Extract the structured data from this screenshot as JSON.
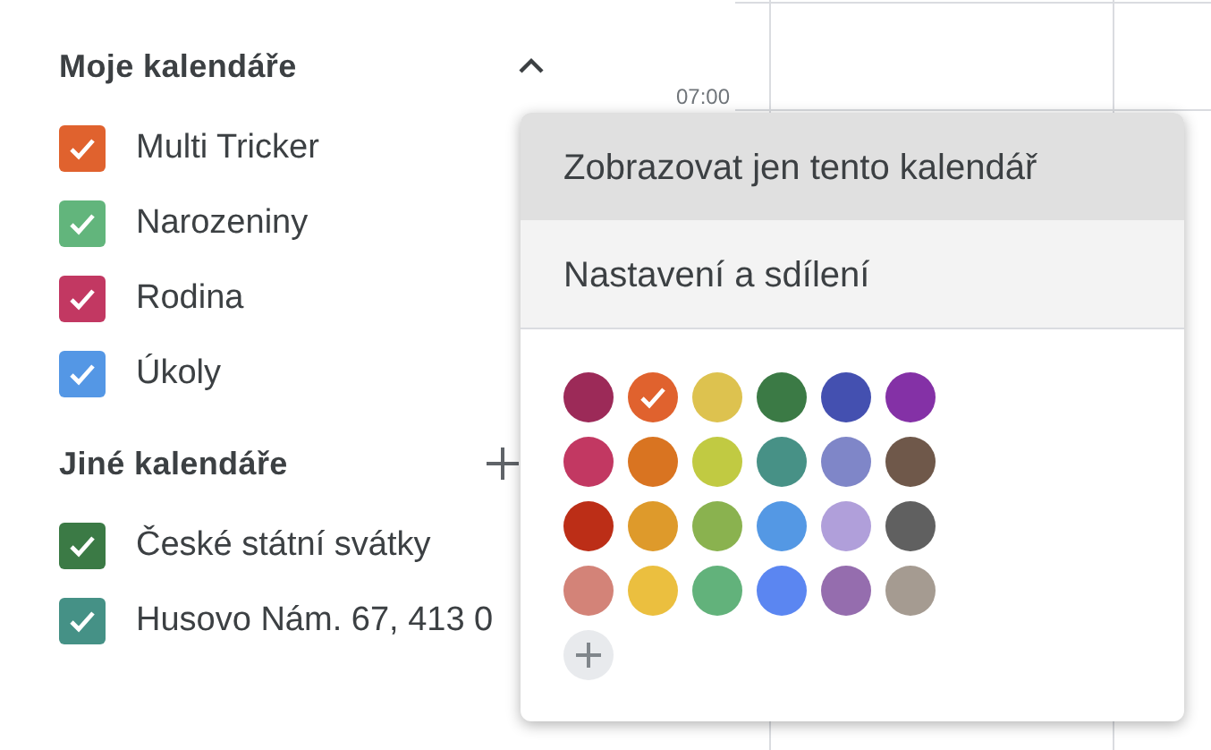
{
  "sidebar": {
    "sections": [
      {
        "title": "Moje kalendáře",
        "kind": "collapse",
        "calendars": [
          {
            "name": "Multi Tricker",
            "color": "#e0622e",
            "checked": true
          },
          {
            "name": "Narozeniny",
            "color": "#62b57c",
            "checked": true
          },
          {
            "name": "Rodina",
            "color": "#c23862",
            "checked": true
          },
          {
            "name": "Úkoly",
            "color": "#5497e5",
            "checked": true
          }
        ]
      },
      {
        "title": "Jiné kalendáře",
        "kind": "add",
        "calendars": [
          {
            "name": "České státní svátky",
            "color": "#3b7a45",
            "checked": true
          },
          {
            "name": "Husovo Nám. 67, 413 0",
            "color": "#459186",
            "checked": true
          }
        ]
      }
    ]
  },
  "time_labels": [
    "07:00"
  ],
  "menu": {
    "items": [
      {
        "label": "Zobrazovat jen tento kalendář",
        "selected": true
      },
      {
        "label": "Nastavení a sdílení",
        "selected": false
      }
    ],
    "swatches": [
      {
        "color": "#9c2a58",
        "selected": false
      },
      {
        "color": "#e0622e",
        "selected": true
      },
      {
        "color": "#ddc24f",
        "selected": false
      },
      {
        "color": "#3b7a45",
        "selected": false
      },
      {
        "color": "#4450b0",
        "selected": false
      },
      {
        "color": "#8431a6",
        "selected": false
      },
      {
        "color": "#c23862",
        "selected": false
      },
      {
        "color": "#d97421",
        "selected": false
      },
      {
        "color": "#c1ca42",
        "selected": false
      },
      {
        "color": "#479186",
        "selected": false
      },
      {
        "color": "#7f86c8",
        "selected": false
      },
      {
        "color": "#6f584a",
        "selected": false
      },
      {
        "color": "#bc2e17",
        "selected": false
      },
      {
        "color": "#de9a2b",
        "selected": false
      },
      {
        "color": "#8ab24f",
        "selected": false
      },
      {
        "color": "#5498e4",
        "selected": false
      },
      {
        "color": "#b09fda",
        "selected": false
      },
      {
        "color": "#606060",
        "selected": false
      },
      {
        "color": "#d38378",
        "selected": false
      },
      {
        "color": "#ebbf3f",
        "selected": false
      },
      {
        "color": "#62b27b",
        "selected": false
      },
      {
        "color": "#5b86f1",
        "selected": false
      },
      {
        "color": "#956dae",
        "selected": false
      },
      {
        "color": "#a59b91",
        "selected": false
      }
    ]
  }
}
